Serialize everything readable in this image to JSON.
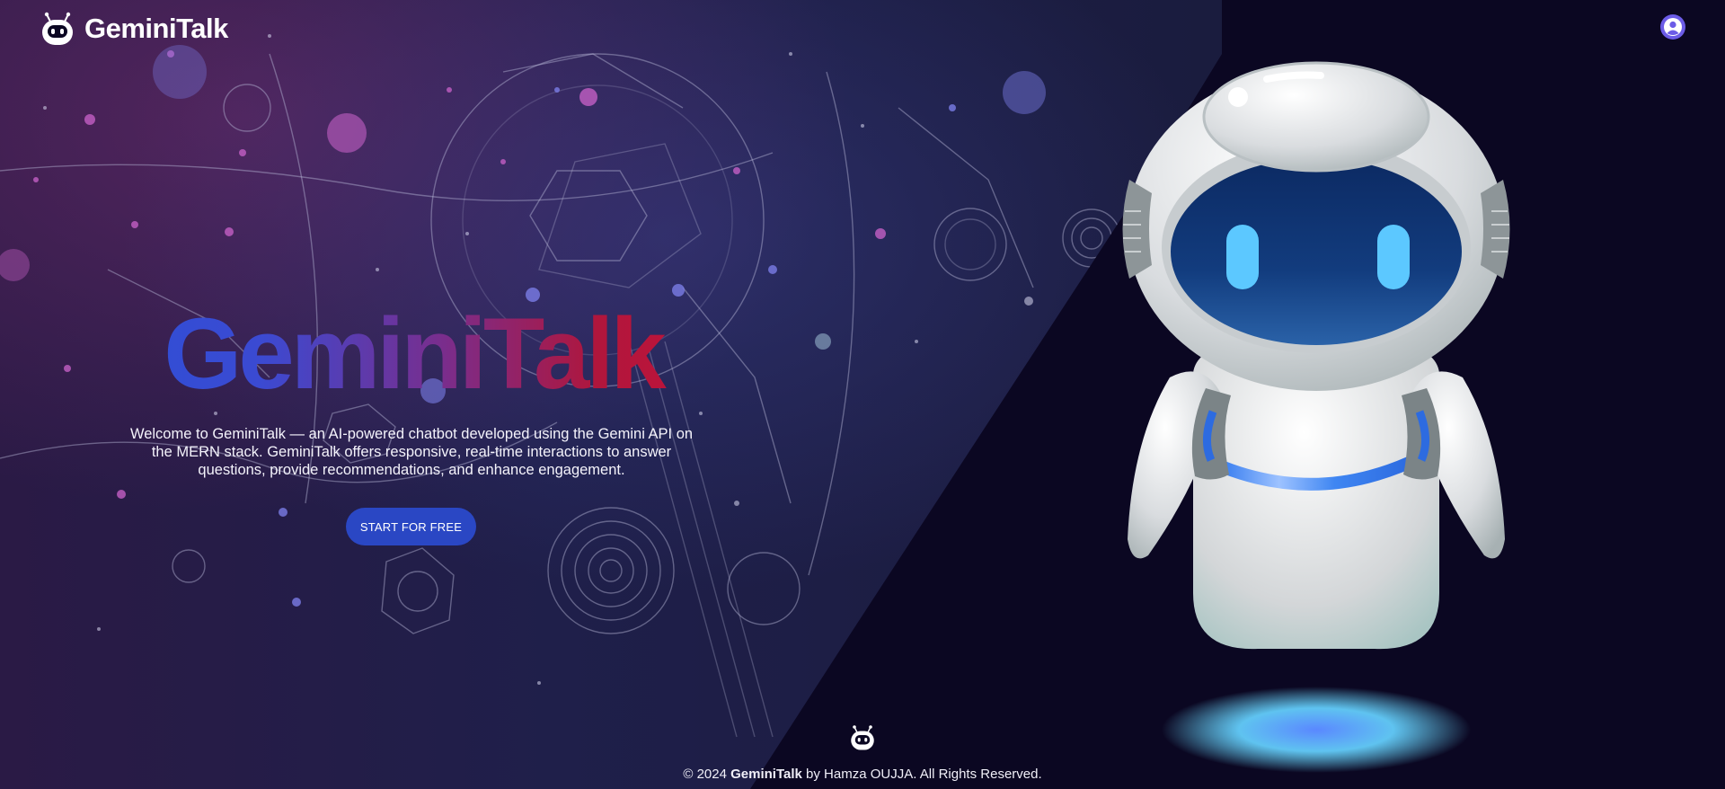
{
  "header": {
    "brand_name": "GeminiTalk",
    "logo_icon": "robot-head-icon",
    "user_icon": "user-avatar-icon"
  },
  "hero": {
    "title": "GeminiTalk",
    "description": "Welcome to GeminiTalk — an AI-powered chatbot developed using the Gemini API on the MERN stack. GeminiTalk offers responsive, real-time interactions to answer questions, provide recommendations, and enhance engagement.",
    "cta_label": "START FOR FREE"
  },
  "footer": {
    "prefix": "© 2024 ",
    "brand": "GeminiTalk",
    "suffix": " by Hamza OUJJA. All Rights Reserved.",
    "logo_icon": "robot-head-icon"
  },
  "colors": {
    "background": "#0b0722",
    "cta": "#2a47c4",
    "title_gradient_start": "#2e4fd6",
    "title_gradient_end": "#c3133a",
    "avatar": "#6c5ce7"
  }
}
